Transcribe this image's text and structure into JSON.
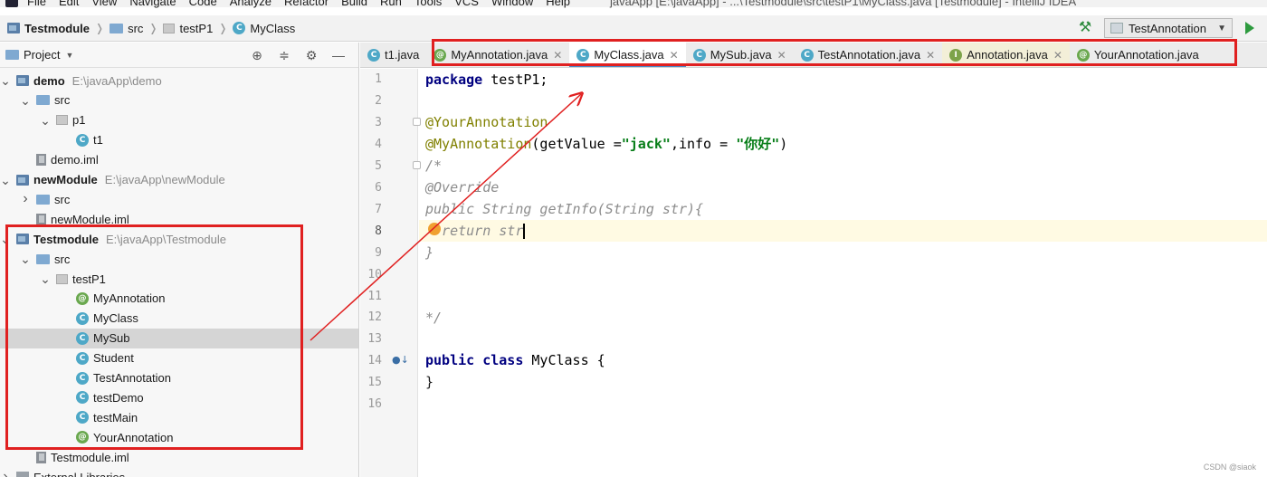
{
  "menu": [
    "File",
    "Edit",
    "View",
    "Navigate",
    "Code",
    "Analyze",
    "Refactor",
    "Build",
    "Run",
    "Tools",
    "VCS",
    "Window",
    "Help"
  ],
  "window_title": "javaApp [E:\\javaApp] - ...\\Testmodule\\src\\testP1\\MyClass.java [Testmodule] - IntelliJ IDEA",
  "breadcrumb": [
    "Testmodule",
    "src",
    "testP1",
    "MyClass"
  ],
  "run_config": "TestAnnotation",
  "project_panel": {
    "title": "Project",
    "tree": [
      {
        "label": "demo",
        "path": "E:\\javaApp\\demo",
        "icon": "module-icon",
        "arrow": "down",
        "indent": 0,
        "bold": true
      },
      {
        "label": "src",
        "icon": "folder-icon",
        "arrow": "down",
        "indent": 1
      },
      {
        "label": "p1",
        "icon": "package-icon",
        "arrow": "down",
        "indent": 2
      },
      {
        "label": "t1",
        "icon": "class-icon",
        "arrow": "",
        "indent": 3
      },
      {
        "label": "demo.iml",
        "icon": "iml-icon",
        "arrow": "",
        "indent": 1
      },
      {
        "label": "newModule",
        "path": "E:\\javaApp\\newModule",
        "icon": "module-icon",
        "arrow": "down",
        "indent": 0,
        "bold": true
      },
      {
        "label": "src",
        "icon": "folder-icon",
        "arrow": "right",
        "indent": 1
      },
      {
        "label": "newModule.iml",
        "icon": "iml-icon",
        "arrow": "",
        "indent": 1
      },
      {
        "label": "Testmodule",
        "path": "E:\\javaApp\\Testmodule",
        "icon": "module-icon",
        "arrow": "down",
        "indent": 0,
        "bold": true
      },
      {
        "label": "src",
        "icon": "folder-icon",
        "arrow": "down",
        "indent": 1
      },
      {
        "label": "testP1",
        "icon": "package-icon",
        "arrow": "down",
        "indent": 2
      },
      {
        "label": "MyAnnotation",
        "icon": "annotation-icon",
        "arrow": "",
        "indent": 3
      },
      {
        "label": "MyClass",
        "icon": "class-icon",
        "arrow": "",
        "indent": 3
      },
      {
        "label": "MySub",
        "icon": "class-icon",
        "arrow": "",
        "indent": 3,
        "selected": true
      },
      {
        "label": "Student",
        "icon": "class-icon",
        "arrow": "",
        "indent": 3
      },
      {
        "label": "TestAnnotation",
        "icon": "class-icon",
        "arrow": "",
        "indent": 3
      },
      {
        "label": "testDemo",
        "icon": "class-icon",
        "arrow": "",
        "indent": 3
      },
      {
        "label": "testMain",
        "icon": "class-icon",
        "arrow": "",
        "indent": 3
      },
      {
        "label": "YourAnnotation",
        "icon": "annotation-icon",
        "arrow": "",
        "indent": 3
      },
      {
        "label": "Testmodule.iml",
        "icon": "iml-icon",
        "arrow": "",
        "indent": 1
      },
      {
        "label": "External Libraries",
        "icon": "library-icon",
        "arrow": "right",
        "indent": 0
      }
    ]
  },
  "tabs": [
    {
      "label": "t1.java",
      "icon": "class-icon",
      "closable": false,
      "active": false
    },
    {
      "label": "MyAnnotation.java",
      "icon": "annotation-icon",
      "closable": true,
      "active": false
    },
    {
      "label": "MyClass.java",
      "icon": "class-icon",
      "closable": true,
      "active": true
    },
    {
      "label": "MySub.java",
      "icon": "class-icon",
      "closable": true,
      "active": false
    },
    {
      "label": "TestAnnotation.java",
      "icon": "class-icon",
      "closable": true,
      "active": false
    },
    {
      "label": "Annotation.java",
      "icon": "interface-icon",
      "closable": true,
      "active": false
    },
    {
      "label": "YourAnnotation.java",
      "icon": "annotation-icon",
      "closable": false,
      "active": false
    }
  ],
  "line_numbers": [
    "1",
    "2",
    "3",
    "4",
    "5",
    "6",
    "7",
    "8",
    "9",
    "10",
    "11",
    "12",
    "13",
    "14",
    "15",
    "16"
  ],
  "code": {
    "l1_kw": "package",
    "l1_rest": " testP1;",
    "l3_ann": "@YourAnnotation",
    "l4_ann": "@MyAnnotation",
    "l4_a": "(getValue =",
    "l4_s1": "\"jack\"",
    "l4_b": ",info = ",
    "l4_s2": "\"你好\"",
    "l4_c": ")",
    "l5": "/*",
    "l6": "@Override",
    "l7": "public String getInfo(String str){",
    "l8": "  return str",
    "l9": "}",
    "l12": "*/",
    "l14_kw1": "public",
    "l14_kw2": "class",
    "l14_rest": " MyClass {",
    "l15": "}"
  },
  "watermark": "CSDN @siaok",
  "annotation_color": "#e02020"
}
